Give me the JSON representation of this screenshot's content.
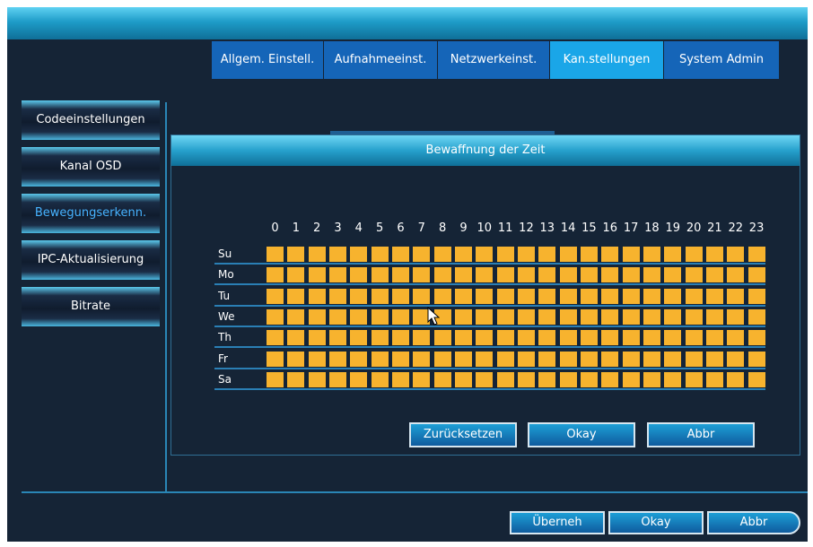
{
  "tabs": [
    {
      "label": "Allgem. Einstell.",
      "active": false
    },
    {
      "label": "Aufnahmeeinst.",
      "active": false
    },
    {
      "label": "Netzwerkeinst.",
      "active": false
    },
    {
      "label": "Kan.stellungen",
      "active": true
    },
    {
      "label": "System Admin",
      "active": false
    }
  ],
  "sidebar": {
    "items": [
      {
        "label": "Codeeinstellungen",
        "active": false
      },
      {
        "label": "Kanal OSD",
        "active": false
      },
      {
        "label": "Bewegungserkenn.",
        "active": true
      },
      {
        "label": "IPC-Aktualisierung",
        "active": false
      },
      {
        "label": "Bitrate",
        "active": false
      }
    ]
  },
  "dialog": {
    "title": "Bewaffnung der Zeit",
    "hours": [
      "0",
      "1",
      "2",
      "3",
      "4",
      "5",
      "6",
      "7",
      "8",
      "9",
      "10",
      "11",
      "12",
      "13",
      "14",
      "15",
      "16",
      "17",
      "18",
      "19",
      "20",
      "21",
      "22",
      "23"
    ],
    "days": [
      "Su",
      "Mo",
      "Tu",
      "We",
      "Th",
      "Fr",
      "Sa"
    ],
    "buttons": {
      "reset": "Zurücksetzen",
      "ok": "Okay",
      "cancel": "Abbr"
    }
  },
  "bottom_buttons": {
    "apply": "Überneh",
    "ok": "Okay",
    "cancel": "Abbr"
  },
  "colors": {
    "accent": "#1aa6e8",
    "tab": "#1565b8",
    "cell_on": "#f7b32e",
    "background": "#152436"
  }
}
